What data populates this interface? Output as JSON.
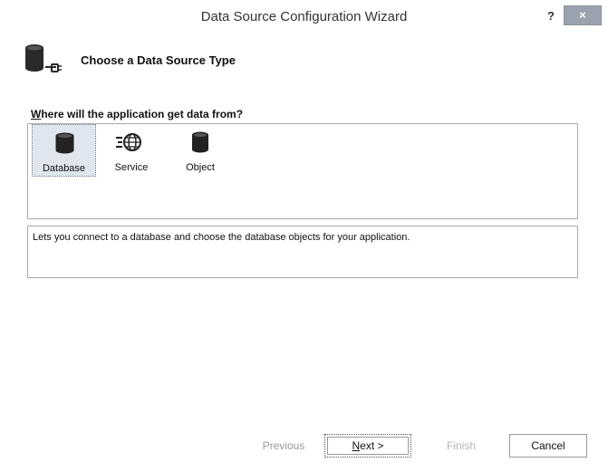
{
  "window": {
    "title": "Data Source Configuration Wizard",
    "help_label": "?",
    "close_label": "×"
  },
  "header": {
    "title": "Choose a Data Source Type",
    "icon": "database-plug-icon"
  },
  "question": {
    "underlined": "W",
    "rest": "here will the application get data from?"
  },
  "data_source_types": [
    {
      "label": "Database",
      "icon": "database-icon",
      "selected": true
    },
    {
      "label": "Service",
      "icon": "service-globe-icon",
      "selected": false
    },
    {
      "label": "Object",
      "icon": "object-icon",
      "selected": false
    }
  ],
  "description": "Lets you connect to a database and choose the database objects for your application.",
  "buttons": {
    "previous": "Previous",
    "next_mnemonic": "N",
    "next_rest": "ext >",
    "finish": "Finish",
    "cancel": "Cancel"
  }
}
